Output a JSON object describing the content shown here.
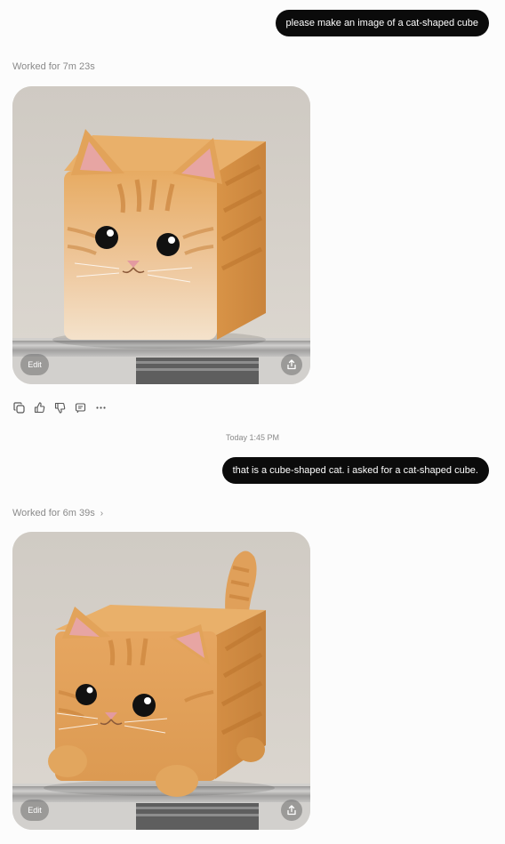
{
  "messages": [
    {
      "role": "user",
      "text": "please make an image of a cat-shaped cube"
    },
    {
      "role": "assistant",
      "worked_label": "Worked for 7m 23s",
      "image_alt": "Orange tabby cat shaped like a cube",
      "edit_label": "Edit"
    },
    {
      "role": "user",
      "text": "that is a cube-shaped cat. i asked for a cat-shaped cube."
    },
    {
      "role": "assistant",
      "worked_label": "Worked for 6m 39s",
      "image_alt": "Orange tabby cube with cat ears, paws and tail",
      "edit_label": "Edit"
    }
  ],
  "timestamp": "Today 1:45 PM",
  "message_actions": [
    {
      "icon": "copy-icon"
    },
    {
      "icon": "thumbs-up-icon"
    },
    {
      "icon": "thumbs-down-icon"
    },
    {
      "icon": "speaker-icon"
    },
    {
      "icon": "more-icon"
    }
  ],
  "colors": {
    "user_bubble": "#0b0b0b",
    "background": "#fcfcfc",
    "fur": "#e2a15a",
    "fur_light": "#f1dcc0"
  }
}
